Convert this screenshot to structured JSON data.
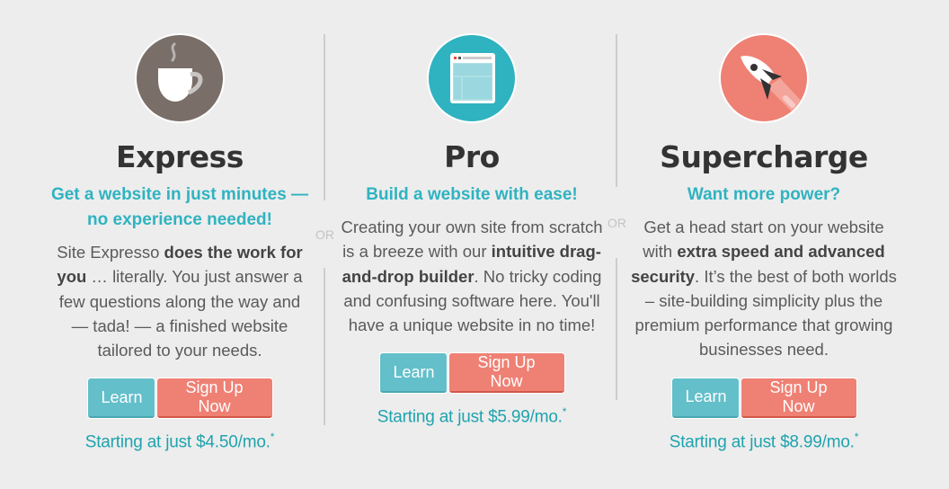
{
  "plans": [
    {
      "id": "express",
      "icon": "coffee-cup-icon",
      "icon_color": "#7a6e69",
      "title": "Express",
      "tagline_line1": "Get a website in just minutes —",
      "tagline_line2": "no experience needed!",
      "desc_parts": [
        "Site Expresso ",
        "does the work for you",
        " … literally. You just answer a few questions along the way and — tada! — a finished website tailored to your needs."
      ],
      "learn_label": "Learn",
      "signup_label": "Sign Up Now",
      "price_text": "Starting at just $4.50/mo.",
      "price_note": "*"
    },
    {
      "id": "pro",
      "icon": "website-builder-icon",
      "icon_color": "#2fb3c1",
      "title": "Pro",
      "tagline_line1": "Build a website with ease!",
      "desc_parts": [
        "Creating your own site from scratch is a breeze with our ",
        "intuitive drag-and-drop builder",
        ". No tricky coding and confusing software here. You'll have a unique website in no time!"
      ],
      "learn_label": "Learn",
      "signup_label": "Sign Up Now",
      "price_text": "Starting at just $5.99/mo.",
      "price_note": "*"
    },
    {
      "id": "supercharge",
      "icon": "rocket-icon",
      "icon_color": "#ef8074",
      "title": "Supercharge",
      "tagline_line1": "Want more power?",
      "desc_parts": [
        "Get a head start on your website with ",
        "extra speed and advanced security",
        ". It’s the best of both worlds – site-building simplicity plus the premium performance that growing businesses need."
      ],
      "learn_label": "Learn",
      "signup_label": "Sign Up Now",
      "price_text": "Starting at just $8.99/mo.",
      "price_note": "*"
    }
  ],
  "separators": {
    "or_label": "OR"
  },
  "colors": {
    "accent_teal": "#2fb3c1",
    "price_teal": "#1fa3ae",
    "learn_button": "#63bfca",
    "signup_button": "#ef8074",
    "background": "#ededed"
  }
}
